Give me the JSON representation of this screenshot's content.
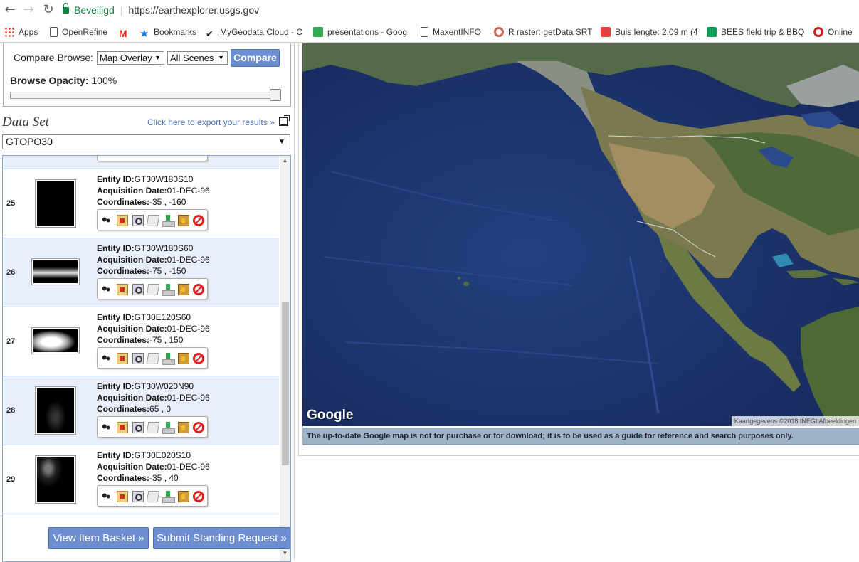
{
  "browser": {
    "secure_label": "Beveiligd",
    "url": "https://earthexplorer.usgs.gov",
    "bookmarks": [
      {
        "label": "Apps",
        "icon": "apps-grid-icon",
        "color": "#e33b2e"
      },
      {
        "label": "OpenRefine",
        "icon": "page-icon",
        "color": "#ffffff"
      },
      {
        "label": "",
        "icon": "gmail-icon",
        "color": "#d93025"
      },
      {
        "label": "Bookmarks",
        "icon": "star-icon",
        "color": "#1a73e8"
      },
      {
        "label": "MyGeodata Cloud - C",
        "icon": "check-icon",
        "color": "#222222"
      },
      {
        "label": "presentations - Goog",
        "icon": "google-drive-icon",
        "color": "#34a853"
      },
      {
        "label": "MaxentINFO",
        "icon": "page-icon",
        "color": "#ffffff"
      },
      {
        "label": "R raster: getData SRT",
        "icon": "r-icon",
        "color": "#cc6655"
      },
      {
        "label": "Buis lengte: 2.09 m (4",
        "icon": "calendar-icon",
        "color": "#e04040"
      },
      {
        "label": "BEES field trip & BBQ",
        "icon": "sheets-icon",
        "color": "#0f9d58"
      },
      {
        "label": "Online",
        "icon": "opera-icon",
        "color": "#cc2222"
      }
    ]
  },
  "compare": {
    "label": "Compare Browse:",
    "overlay_value": "Map Overlay",
    "scenes_value": "All Scenes",
    "button": "Compare",
    "opacity_label": "Browse Opacity:",
    "opacity_value": "100%",
    "opacity_level": 1.0
  },
  "dataset": {
    "title": "Data Set",
    "export_link": "Click here to export your results »",
    "selected": "GTOPO30"
  },
  "results": [
    {
      "num": "25",
      "entity": "GT30W180S10",
      "date": "01-DEC-96",
      "coords": "-35 , -160"
    },
    {
      "num": "26",
      "entity": "GT30W180S60",
      "date": "01-DEC-96",
      "coords": "-75 , -150"
    },
    {
      "num": "27",
      "entity": "GT30E120S60",
      "date": "01-DEC-96",
      "coords": "-75 , 150"
    },
    {
      "num": "28",
      "entity": "GT30W020N90",
      "date": "01-DEC-96",
      "coords": "65 , 0"
    },
    {
      "num": "29",
      "entity": "GT30E020S10",
      "date": "01-DEC-96",
      "coords": "-35 , 40"
    }
  ],
  "labels": {
    "entity": "Entity ID:",
    "date": "Acquisition Date:",
    "coords": "Coordinates:"
  },
  "buttons": {
    "basket": "View Item Basket »",
    "standing": "Submit Standing Request »"
  },
  "map": {
    "logo": "Google",
    "attribution": "Kaartgegevens ©2018 INEGI Afbeeldingen",
    "note": "The up-to-date Google map is not for purchase or for download; it is to be used as a guide for reference and search purposes only."
  },
  "colors": {
    "accent_button": "#6d8fd2",
    "row_alt": "#e8eefa",
    "ocean": "#1d3470",
    "land": "#6a7a4a"
  }
}
